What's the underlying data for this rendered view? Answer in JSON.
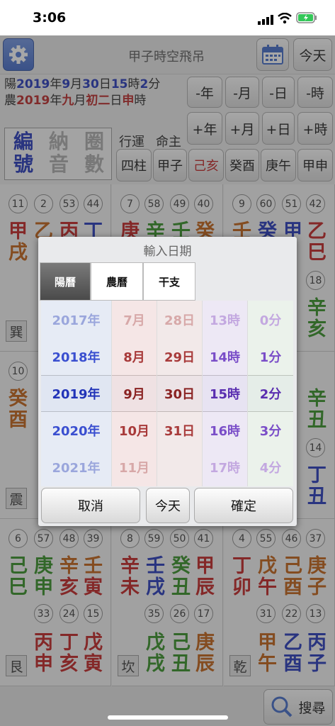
{
  "status": {
    "time": "3:06"
  },
  "topbar": {
    "title": "甲子時空飛吊",
    "today_label": "今天"
  },
  "info": {
    "solar_prefix": "陽",
    "solar_year": "2019",
    "year_word": "年",
    "solar_month": "9",
    "month_word": "月",
    "solar_day": "30",
    "day_word": "日",
    "solar_hour": "15",
    "hour_word": "時",
    "solar_min": "2",
    "min_word": "分",
    "lunar_prefix": "農",
    "lunar_year": "2019",
    "lunar_month": "九",
    "lunar_day_pre": "初二",
    "lunar_hour": "申"
  },
  "nav": {
    "minus_year": "-年",
    "minus_month": "-月",
    "minus_day": "-日",
    "minus_hour": "-時",
    "plus_year": "+年",
    "plus_month": "+月",
    "plus_day": "+日",
    "plus_hour": "+時"
  },
  "modes": {
    "c1": "編",
    "c2": "號",
    "c3": "納",
    "c4": "音",
    "c5": "圈",
    "c6": "數"
  },
  "selectors": {
    "xingyun": "行運",
    "mingzhu": "命主",
    "sizhu": "四柱",
    "jiazi": "甲子",
    "jihai": "己亥",
    "guiyou": "癸酉",
    "gengwu": "庚午",
    "jiashen": "甲申"
  },
  "grid": {
    "c1": {
      "n1": "11",
      "n2": "2",
      "n3": "53",
      "n4": "44",
      "g1": "甲",
      "g2": "戌",
      "g3": "乙",
      "g4": "丙",
      "g5": "丁",
      "gua": "巽"
    },
    "c2": {
      "n1": "7",
      "n2": "58",
      "n3": "49",
      "n4": "40",
      "g1": "庚",
      "g2": "辛",
      "g3": "壬",
      "g4": "癸"
    },
    "c3": {
      "n1": "9",
      "n2": "60",
      "n3": "51",
      "n4": "42",
      "g1": "壬",
      "g2": "癸",
      "g3": "甲",
      "g4": "乙",
      "g5": "巳",
      "n5": "18",
      "g6": "辛",
      "g7": "亥"
    },
    "c4": {
      "n1": "10",
      "g1": "癸",
      "g2": "酉",
      "gua": "震"
    },
    "c6": {
      "n1": "14",
      "g1": "辛",
      "g2": "丑",
      "g3": "丁",
      "g4": "丑"
    },
    "c7": {
      "n1": "6",
      "n2": "57",
      "n3": "48",
      "n4": "39",
      "g1": "己",
      "g2": "庚",
      "g3": "辛",
      "g4": "壬",
      "g5": "巳",
      "g6": "申",
      "g7": "亥",
      "g8": "寅",
      "n5": "33",
      "n6": "24",
      "n7": "15",
      "g9": "丙",
      "g10": "丁",
      "g11": "戊",
      "g12": "申",
      "g13": "亥",
      "g14": "寅",
      "gua": "艮"
    },
    "c8": {
      "n1": "8",
      "n2": "59",
      "n3": "50",
      "n4": "41",
      "g1": "辛",
      "g2": "壬",
      "g3": "癸",
      "g4": "甲",
      "g5": "未",
      "g6": "戌",
      "g7": "丑",
      "g8": "辰",
      "n5": "35",
      "n6": "26",
      "n7": "17",
      "g9": "戊",
      "g10": "己",
      "g11": "庚",
      "g12": "戌",
      "g13": "丑",
      "g14": "辰",
      "gua": "坎"
    },
    "c9": {
      "n1": "4",
      "n2": "55",
      "n3": "46",
      "n4": "37",
      "g1": "丁",
      "g2": "戊",
      "g3": "己",
      "g4": "庚",
      "g5": "卯",
      "g6": "午",
      "g7": "酉",
      "g8": "子",
      "n5": "31",
      "n6": "22",
      "n7": "13",
      "g9": "甲",
      "g10": "乙",
      "g11": "丙",
      "g12": "午",
      "g13": "酉",
      "g14": "子",
      "gua": "乾"
    }
  },
  "dialog": {
    "title": "輸入日期",
    "tabs": {
      "solar": "陽曆",
      "lunar": "農曆",
      "ganzhi": "干支"
    },
    "years": [
      "2017年",
      "2018年",
      "2019年",
      "2020年",
      "2021年"
    ],
    "months": [
      "7月",
      "8月",
      "9月",
      "10月",
      "11月"
    ],
    "days": [
      "28日",
      "29日",
      "30日",
      "31日",
      ""
    ],
    "hours": [
      "13時",
      "14時",
      "15時",
      "16時",
      "17時"
    ],
    "mins": [
      "0分",
      "1分",
      "2分",
      "3分",
      "4分"
    ],
    "cancel": "取消",
    "today": "今天",
    "confirm": "確定"
  },
  "bottom": {
    "search": "搜尋"
  }
}
